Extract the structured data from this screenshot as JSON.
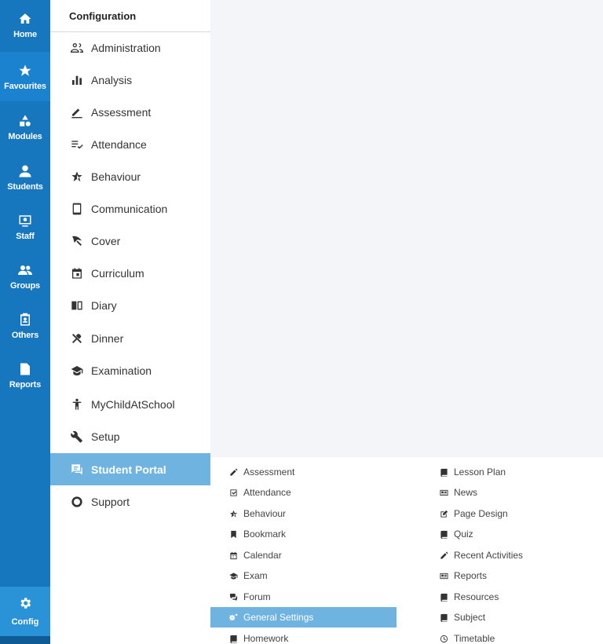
{
  "rail": {
    "items": [
      {
        "label": "Home",
        "icon": "home-icon"
      },
      {
        "label": "Favourites",
        "icon": "star-icon"
      },
      {
        "label": "Modules",
        "icon": "shapes-icon"
      },
      {
        "label": "Students",
        "icon": "person-icon"
      },
      {
        "label": "Staff",
        "icon": "staff-screen-icon"
      },
      {
        "label": "Groups",
        "icon": "group-icon"
      },
      {
        "label": "Others",
        "icon": "badge-icon"
      },
      {
        "label": "Reports",
        "icon": "document-icon"
      }
    ],
    "config": {
      "label": "Config",
      "icon": "gear-icon"
    }
  },
  "config_menu": {
    "title": "Configuration",
    "items": [
      {
        "label": "Administration",
        "icon": "people-outline-icon"
      },
      {
        "label": "Analysis",
        "icon": "bar-chart-icon"
      },
      {
        "label": "Assessment",
        "icon": "pencil-line-icon"
      },
      {
        "label": "Attendance",
        "icon": "list-check-icon"
      },
      {
        "label": "Behaviour",
        "icon": "star-half-icon"
      },
      {
        "label": "Communication",
        "icon": "phone-icon"
      },
      {
        "label": "Cover",
        "icon": "umbrella-icon"
      },
      {
        "label": "Curriculum",
        "icon": "calendar-icon"
      },
      {
        "label": "Diary",
        "icon": "book-open-icon"
      },
      {
        "label": "Dinner",
        "icon": "utensils-icon"
      },
      {
        "label": "Examination",
        "icon": "graduation-cap-icon"
      },
      {
        "label": "MyChildAtSchool",
        "icon": "person-standing-icon"
      },
      {
        "label": "Setup",
        "icon": "wrench-icon"
      },
      {
        "label": "Student Portal",
        "icon": "chat-icon"
      },
      {
        "label": "Support",
        "icon": "ring-icon"
      }
    ],
    "active": "Student Portal"
  },
  "submenu": {
    "col1": [
      {
        "label": "Assessment",
        "icon": "pencil-icon"
      },
      {
        "label": "Attendance",
        "icon": "check-square-icon"
      },
      {
        "label": "Behaviour",
        "icon": "star-half-icon"
      },
      {
        "label": "Bookmark",
        "icon": "bookmark-icon"
      },
      {
        "label": "Calendar",
        "icon": "calendar-icon"
      },
      {
        "label": "Exam",
        "icon": "graduation-cap-icon"
      },
      {
        "label": "Forum",
        "icon": "comments-icon"
      },
      {
        "label": "General Settings",
        "icon": "gears-icon"
      },
      {
        "label": "Homework",
        "icon": "book-icon"
      }
    ],
    "col2": [
      {
        "label": "Lesson Plan",
        "icon": "book-icon"
      },
      {
        "label": "News",
        "icon": "newspaper-icon"
      },
      {
        "label": "Page Design",
        "icon": "edit-square-icon"
      },
      {
        "label": "Quiz",
        "icon": "book-icon"
      },
      {
        "label": "Recent Activities",
        "icon": "pencil-icon"
      },
      {
        "label": "Reports",
        "icon": "newspaper-icon"
      },
      {
        "label": "Resources",
        "icon": "book-icon"
      },
      {
        "label": "Subject",
        "icon": "book-icon"
      },
      {
        "label": "Timetable",
        "icon": "clock-icon"
      }
    ],
    "selected": "General Settings"
  },
  "colors": {
    "rail": "#1677bf",
    "active_highlight": "#6fb3e0",
    "content_bg": "#f4f5f8"
  }
}
